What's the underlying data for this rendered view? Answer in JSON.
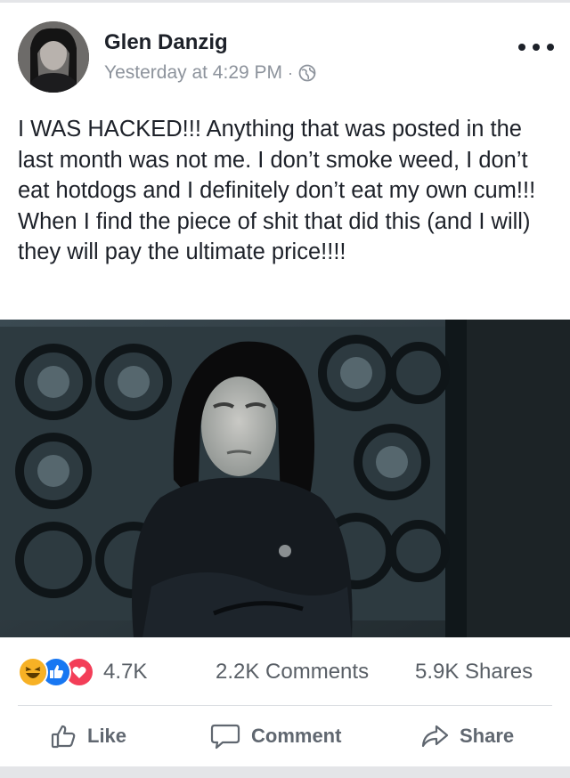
{
  "post": {
    "author": "Glen Danzig",
    "timestamp": "Yesterday at 4:29 PM",
    "separator": "·",
    "privacy_icon": "globe-icon",
    "more_icon": "more-options-icon",
    "text": "I WAS HACKED!!! Anything that was posted in the last month was not me. I don’t smoke weed, I don’t eat hotdogs and I definitely don’t eat my own cum!!! When I find the piece of shit that did this (and I will) they will pay the ultimate price!!!!"
  },
  "engagement": {
    "reaction_icons": [
      "haha-icon",
      "like-icon",
      "love-icon"
    ],
    "reactions": "4.7K",
    "comments": "2.2K Comments",
    "shares": "5.9K Shares"
  },
  "actions": {
    "like": "Like",
    "comment": "Comment",
    "share": "Share"
  },
  "colors": {
    "like_blue": "#1877f2",
    "love_red": "#f33e58",
    "haha_yellow": "#f7b125",
    "meta_gray": "#8d939c",
    "action_gray": "#606770"
  }
}
